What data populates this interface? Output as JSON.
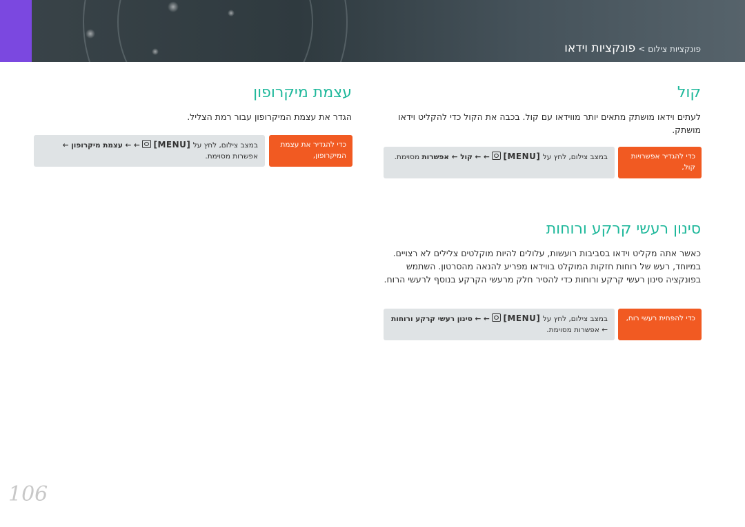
{
  "header": {
    "breadcrumb_parent": "פונקציות צילום",
    "breadcrumb_separator": ">",
    "breadcrumb_current": "פונקציות וידאו"
  },
  "sections": {
    "quality": {
      "title": "קול",
      "body": "לעתים וידאו מושתק מתאים יותר מווידאו עם קול. בכבה את הקול כדי להקליט וידאו מושתק.",
      "orange_label": "כדי להגדיר אפשרויות קול,",
      "path_prefix": "במצב צילום, לחץ על",
      "path_menu": "[MENU]",
      "path_steps": "← ← קול ← אפשרות",
      "path_suffix": "מסוימת."
    },
    "mic": {
      "title": "עצמת מיקרופון",
      "body": "הגדר את עצמת המיקרופון עבור רמת הצליל.",
      "orange_label": "כדי להגדיר את עצמת המיקרופון,",
      "path_prefix": "במצב צילום, לחץ על",
      "path_menu": "[MENU]",
      "path_steps": "← ← עצמת מיקרופון ←",
      "path_suffix": "אפשרות מסוימת."
    },
    "wind": {
      "title": "סינון רעשי קרקע ורוחות",
      "body": "כאשר אתה מקליט וידאו בסביבות רועשות, עלולים להיות מוקלטים צלילים לא רצויים. במיוחד, רעש של רוחות חזקות המוקלט בווידאו מפריע להנאה מהסרטון. השתמש בפונקציה סינון רעשי קרקע ורוחות כדי להסיר חלק מרעשי הקרקע בנוסף לרעשי הרוח.",
      "orange_label": "כדי להפחית רעשי רוח,",
      "path_prefix": "במצב צילום, לחץ על",
      "path_menu": "[MENU]",
      "path_steps": "← ← סינון רעשי קרקע ורוחות",
      "path_suffix": "← אפשרות מסוימת."
    }
  },
  "page_number": "106",
  "colors": {
    "accent_title": "#1fb89b",
    "orange": "#f15a22",
    "tab_purple": "#7b48e0"
  }
}
